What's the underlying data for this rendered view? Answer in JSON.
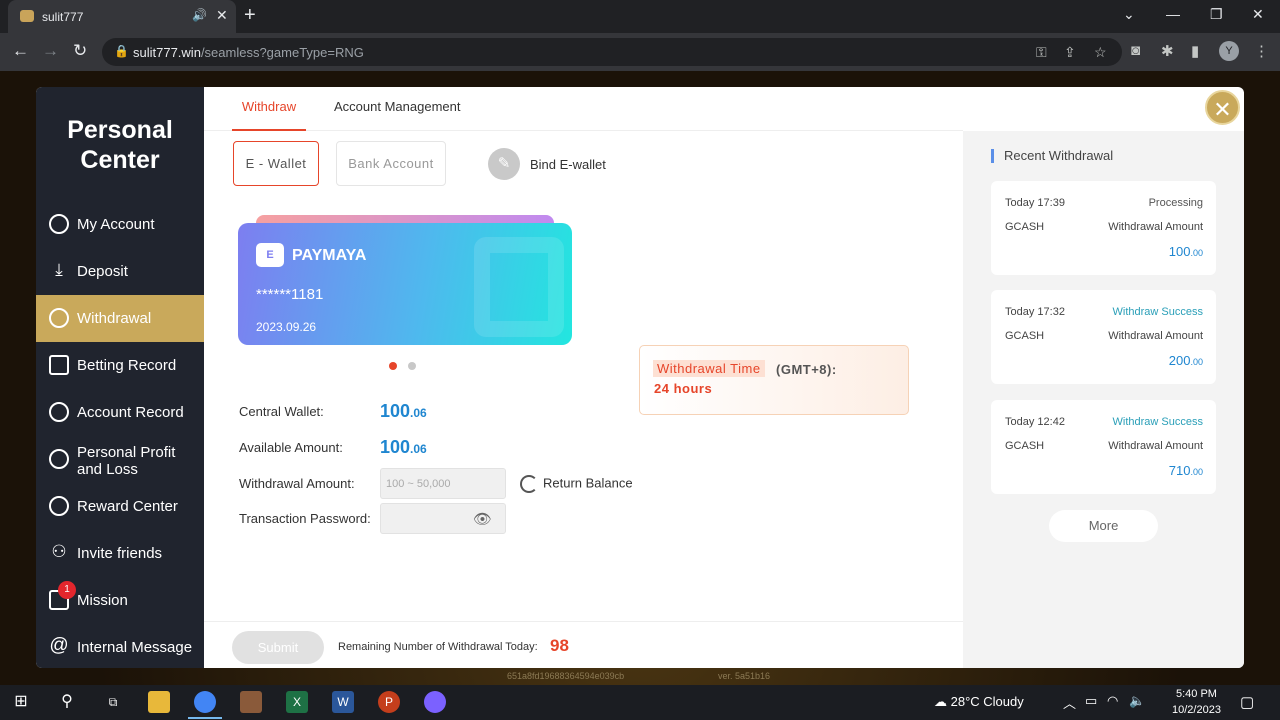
{
  "browser": {
    "tab_title": "sulit777",
    "tab_close": "✕",
    "new_tab": "+",
    "url_host": "sulit777.win",
    "url_path": "/seamless?gameType=RNG",
    "profile_initial": "Y"
  },
  "sidebar": {
    "title_line1": "Personal",
    "title_line2": "Center",
    "items": [
      {
        "label": "My Account"
      },
      {
        "label": "Deposit"
      },
      {
        "label": "Withdrawal"
      },
      {
        "label": "Betting Record"
      },
      {
        "label": "Account Record"
      },
      {
        "label": "Personal Profit and Loss"
      },
      {
        "label": "Reward Center"
      },
      {
        "label": "Invite friends"
      },
      {
        "label": "Mission",
        "badge": "1"
      },
      {
        "label": "Internal Message"
      }
    ]
  },
  "topnav": {
    "withdraw": "Withdraw",
    "account_management": "Account Management"
  },
  "subtabs": {
    "ewallet": "E - Wallet",
    "bank": "Bank Account",
    "bind": "Bind E-wallet"
  },
  "card": {
    "bank": "PAYMAYA",
    "logo": "E",
    "account": "******1181",
    "date": "2023.09.26"
  },
  "fields": {
    "central_wallet_label": "Central Wallet:",
    "central_wallet_int": "100",
    "central_wallet_dec": ".06",
    "available_label": "Available Amount:",
    "available_int": "100",
    "available_dec": ".06",
    "withdrawal_label": "Withdrawal Amount:",
    "withdrawal_placeholder": "100 ~ 50,000",
    "password_label": "Transaction Password:",
    "return_balance": "Return Balance"
  },
  "withdrawal_time": {
    "label": "Withdrawal Time",
    "tz": "(GMT+8):",
    "hours": "24 hours"
  },
  "bottom": {
    "submit": "Submit",
    "remaining_label": "Remaining Number of Withdrawal Today:",
    "remaining_count": "98"
  },
  "recent": {
    "title": "Recent Withdrawal",
    "items": [
      {
        "time": "Today 17:39",
        "status": "Processing",
        "method": "GCASH",
        "amount_label": "Withdrawal Amount",
        "amount_int": "100",
        "amount_dec": ".00"
      },
      {
        "time": "Today 17:32",
        "status": "Withdraw Success",
        "method": "GCASH",
        "amount_label": "Withdrawal Amount",
        "amount_int": "200",
        "amount_dec": ".00"
      },
      {
        "time": "Today 12:42",
        "status": "Withdraw Success",
        "method": "GCASH",
        "amount_label": "Withdrawal Amount",
        "amount_int": "710",
        "amount_dec": ".00"
      }
    ],
    "more": "More"
  },
  "footer": {
    "hash": "651a8fd19688364594e039cb",
    "version": "ver. 5a51b16"
  },
  "taskbar": {
    "weather": "28°C  Cloudy",
    "time": "5:40 PM",
    "date": "10/2/2023"
  },
  "colors": {
    "accent": "#e6452a",
    "gold": "#c9a95b",
    "amount_blue": "#1f86d0",
    "sidebar_bg": "#20242e"
  }
}
